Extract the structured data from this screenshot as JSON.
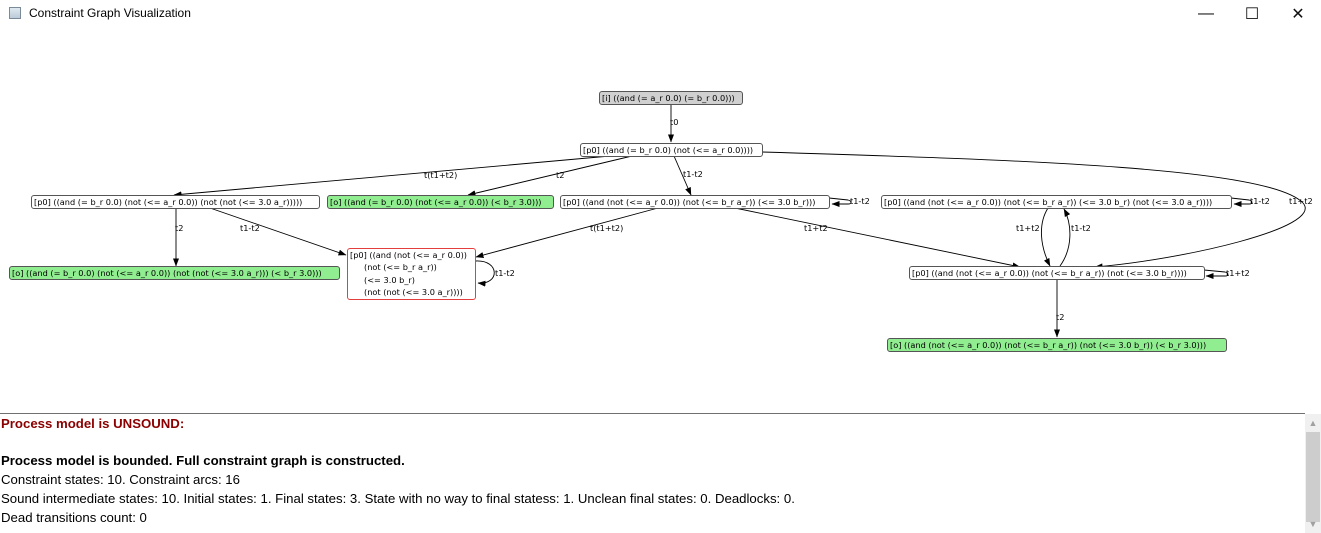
{
  "window": {
    "title": "Constraint Graph Visualization",
    "icon": "app-window-icon",
    "controls": {
      "minimize": "—",
      "maximize": "☐",
      "close": "✕"
    }
  },
  "colors": {
    "initial_fill": "#d0d0d0",
    "final_fill": "#90ee90",
    "unsound_border": "#e53e3e",
    "edge": "#000000",
    "unsound_text": "#8b0000"
  },
  "graph": {
    "nodes": [
      {
        "id": "n_init",
        "kind": "initial",
        "text": "[i] ((and (= a_r 0.0) (= b_r 0.0)))"
      },
      {
        "id": "n_root",
        "kind": "normal",
        "text": "[p0] ((and (= b_r 0.0) (not (<= a_r 0.0))))"
      },
      {
        "id": "n_left",
        "kind": "normal",
        "text": "[p0] ((and (= b_r 0.0) (not (<= a_r 0.0)) (not (not (<= 3.0 a_r)))))"
      },
      {
        "id": "n_final1",
        "kind": "final",
        "text": "[o] ((and (= b_r 0.0) (not (<= a_r 0.0)) (< b_r 3.0)))"
      },
      {
        "id": "n_mid",
        "kind": "normal",
        "text": "[p0] ((and (not (<= a_r 0.0)) (not (<= b_r a_r)) (<= 3.0 b_r)))"
      },
      {
        "id": "n_right",
        "kind": "normal",
        "text": "[p0] ((and (not (<= a_r 0.0)) (not (<= b_r a_r)) (<= 3.0 b_r) (not (<= 3.0 a_r))))"
      },
      {
        "id": "n_final0",
        "kind": "final",
        "text": "[o] ((and (= b_r 0.0) (not (<= a_r 0.0)) (not (not (<= 3.0 a_r))) (< b_r 3.0)))"
      },
      {
        "id": "n_unsound",
        "kind": "unsound",
        "lines": [
          "[p0] ((and (not (<= a_r 0.0))",
          "(not (<= b_r a_r))",
          "(<= 3.0 b_r)",
          "(not (not (<= 3.0 a_r))))"
        ]
      },
      {
        "id": "n_rlow",
        "kind": "normal",
        "text": "[p0] ((and (not (<= a_r 0.0)) (not (<= b_r a_r)) (not (<= 3.0 b_r))))"
      },
      {
        "id": "n_final2",
        "kind": "final",
        "text": "[o] ((and (not (<= a_r 0.0)) (not (<= b_r a_r)) (not (<= 3.0 b_r)) (< b_r 3.0)))"
      }
    ],
    "edges": [
      {
        "from": "n_init",
        "to": "n_root",
        "label": "t0"
      },
      {
        "from": "n_root",
        "to": "n_left",
        "label": "t(t1+t2)"
      },
      {
        "from": "n_root",
        "to": "n_final1",
        "label": "t2"
      },
      {
        "from": "n_root",
        "to": "n_mid",
        "label": "t1-t2"
      },
      {
        "from": "n_root",
        "to": "n_rlow",
        "label": "t1+t2"
      },
      {
        "from": "n_left",
        "to": "n_final0",
        "label": "t2"
      },
      {
        "from": "n_left",
        "to": "n_unsound",
        "label": "t1-t2"
      },
      {
        "from": "n_mid",
        "to": "n_unsound",
        "label": "t(t1+t2)"
      },
      {
        "from": "n_mid",
        "to": "n_rlow",
        "label": "t1+t2"
      },
      {
        "from": "n_mid",
        "to": "n_mid",
        "label": "t1-t2"
      },
      {
        "from": "n_right",
        "to": "n_right",
        "label": "t1-t2"
      },
      {
        "from": "n_right",
        "to": "n_rlow",
        "label": "t1+t2"
      },
      {
        "from": "n_rlow",
        "to": "n_right",
        "label": "t1-t2"
      },
      {
        "from": "n_unsound",
        "to": "n_unsound",
        "label": "t1-t2"
      },
      {
        "from": "n_rlow",
        "to": "n_rlow",
        "label": "t1+t2"
      },
      {
        "from": "n_rlow",
        "to": "n_final2",
        "label": "t2"
      }
    ]
  },
  "output": {
    "unsound": "Process model is UNSOUND:",
    "bounded": "Process model is bounded. Full constraint graph is constructed.",
    "states": "Constraint states: 10. Constraint arcs: 16",
    "summary": "Sound intermediate states: 10. Initial states: 1. Final states: 3. State with no way to final statess: 1. Unclean final states: 0. Deadlocks: 0.",
    "dead": "Dead transitions count: 0"
  },
  "scrollbar": {
    "up_arrow": "scroll-up-icon",
    "down_arrow": "scroll-down-icon"
  }
}
